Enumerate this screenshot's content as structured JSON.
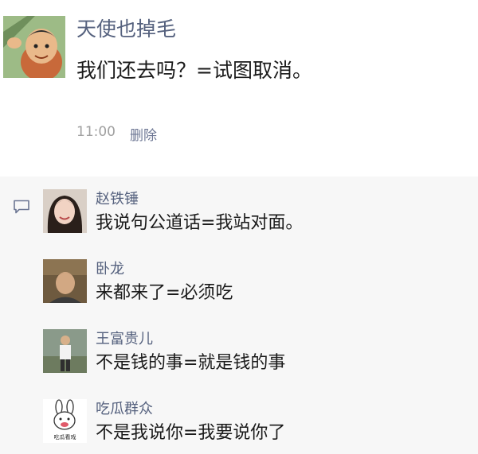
{
  "post": {
    "author": "天使也掉毛",
    "text": "我们还去吗？=试图取消。",
    "time": "11:00",
    "delete_label": "删除",
    "avatar_icon": "cartoon-man-avatar"
  },
  "comment_icon": "comment-bubble-icon",
  "comments": [
    {
      "author": "赵铁锤",
      "text": "我说句公道话=我站对面。",
      "avatar_icon": "woman-photo-avatar"
    },
    {
      "author": "卧龙",
      "text": "来都来了=必须吃",
      "avatar_icon": "man-photo-avatar"
    },
    {
      "author": "王富贵儿",
      "text": "不是钱的事=就是钱的事",
      "avatar_icon": "standing-man-avatar"
    },
    {
      "author": "吃瓜群众",
      "text": "不是我说你=我要说你了",
      "avatar_icon": "bunny-sticker-avatar",
      "avatar_caption": "吃瓜看戏"
    }
  ]
}
